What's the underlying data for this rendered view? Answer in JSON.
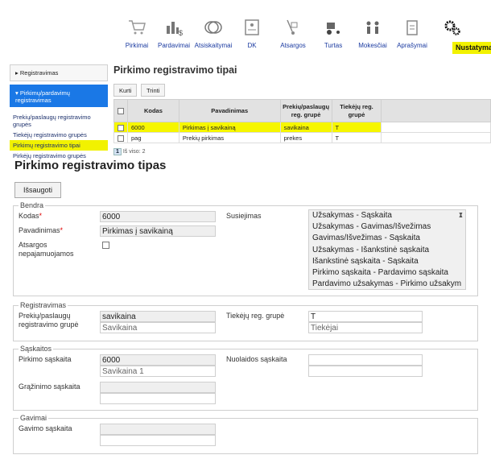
{
  "toolbar": {
    "items": [
      {
        "label": "Pirkimai",
        "icon": "cart-icon"
      },
      {
        "label": "Pardavimai",
        "icon": "bar-chart-dollar-icon"
      },
      {
        "label": "Atsiskaitymai",
        "icon": "coins-icon"
      },
      {
        "label": "DK",
        "icon": "ledger-icon"
      },
      {
        "label": "Atsargos",
        "icon": "hand-truck-icon"
      },
      {
        "label": "Turtas",
        "icon": "tractor-icon"
      },
      {
        "label": "Mokesčiai",
        "icon": "people-icon"
      },
      {
        "label": "Aprašymai",
        "icon": "clipboard-icon"
      },
      {
        "label": "Nustatymai",
        "icon": "gears-icon"
      }
    ]
  },
  "leftnav": {
    "registravimas": "Registravimas",
    "selected": "Pirkimų/pardavimų registravimas",
    "subitems": [
      "Prekių/paslaugų registravimo grupės",
      "Tiekėjų registravimo grupės",
      "Pirkimų registravimo tipai",
      "Pirkėjų registravimo grupės"
    ]
  },
  "list": {
    "title": "Pirkimo registravimo tipai",
    "buttons": {
      "create": "Kurti",
      "delete": "Trinti"
    },
    "columns": {
      "kodas": "Kodas",
      "pavadinimas": "Pavadinimas",
      "prekiu_line1": "Prekių/paslaugų",
      "prekiu_line2": "reg. grupė",
      "tiekeju_line1": "Tiekėjų reg.",
      "tiekeju_line2": "grupė"
    },
    "rows": [
      {
        "kodas": "6000",
        "pavadinimas": "Pirkimas į savikainą",
        "prekiu": "savikaina",
        "tiekeju": "T"
      },
      {
        "kodas": "pag",
        "pavadinimas": "Prekių pirkimas",
        "prekiu": "prekes",
        "tiekeju": "T"
      }
    ],
    "pager": {
      "page": "1",
      "total": "Iš viso: 2"
    }
  },
  "form": {
    "title": "Pirkimo registravimo tipas",
    "save": "Išsaugoti",
    "bendra": {
      "legend": "Bendra",
      "kodas_label": "Kodas",
      "kodas_value": "6000",
      "pavadinimas_label": "Pavadinimas",
      "pavadinimas_value": "Pirkimas į savikainą",
      "atsargos_label": "Atsargos nepajamuojamos",
      "susiejimas_label": "Susiejimas",
      "susiejimas_options": [
        "Užsakymas - Sąskaita",
        "Užsakymas - Gavimas/Išvežimas",
        "Gavimas/Išvežimas - Sąskaita",
        "Užsakymas - Išankstinė sąskaita",
        "Išankstinė sąskaita - Sąskaita",
        "Pirkimo sąskaita - Pardavimo sąskaita",
        "Pardavimo užsakymas - Pirkimo užsakym"
      ]
    },
    "registravimas": {
      "legend": "Registravimas",
      "prekiu_label": "Prekių/paslaugų registravimo grupė",
      "prekiu_value": "savikaina",
      "prekiu_desc": "Savikaina",
      "tiekeju_label": "Tiekėjų reg. grupė",
      "tiekeju_value": "T",
      "tiekeju_desc": "Tiekėjai"
    },
    "saskaitos": {
      "legend": "Sąskaitos",
      "pirkimo_label": "Pirkimo sąskaita",
      "pirkimo_value": "6000",
      "pirkimo_desc": "Savikaina 1",
      "nuolaidos_label": "Nuolaidos sąskaita",
      "grazinimo_label": "Grąžinimo sąskaita"
    },
    "gavimai": {
      "legend": "Gavimai",
      "gavimo_label": "Gavimo sąskaita"
    }
  }
}
